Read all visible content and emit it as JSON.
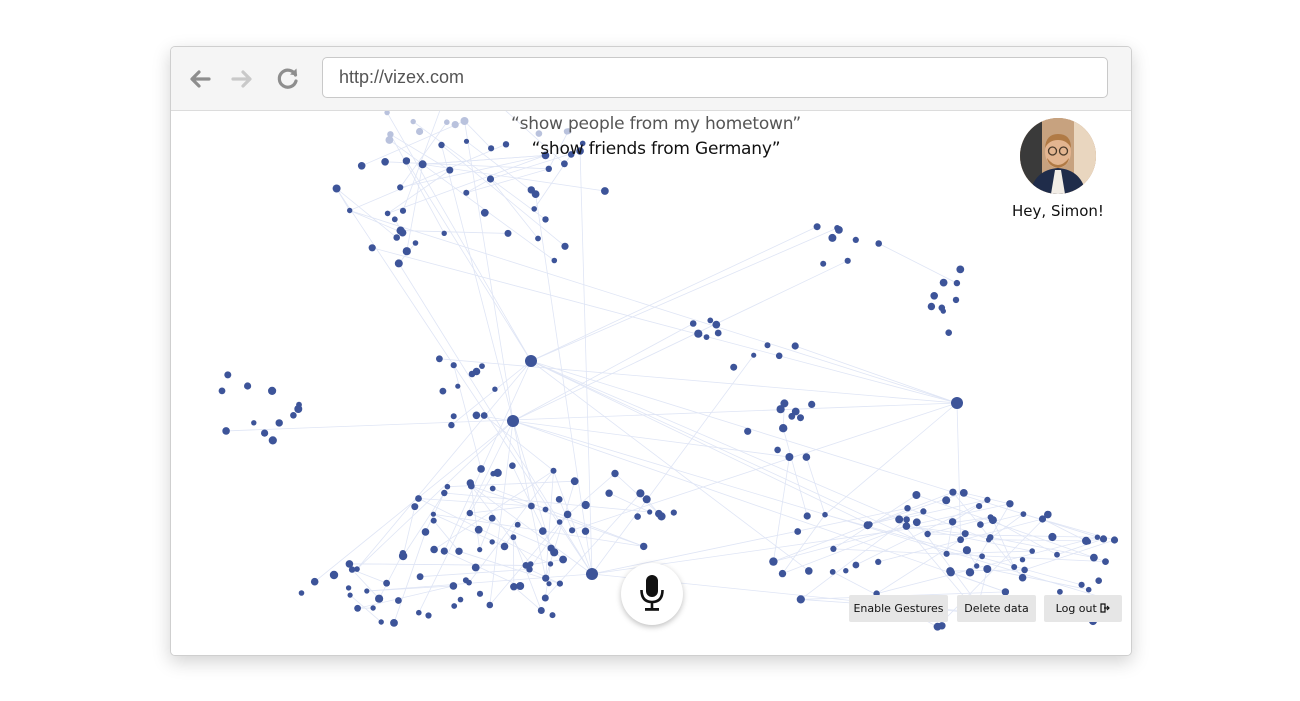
{
  "browser": {
    "url": "http://vizex.com",
    "back_icon": "arrow-left-icon",
    "forward_icon": "arrow-right-icon",
    "reload_icon": "reload-icon"
  },
  "voice_queries": [
    "“show people from my hometown”",
    "“show friends from Germany”"
  ],
  "user": {
    "greeting": "Hey, Simon!"
  },
  "mic": {
    "icon": "microphone-icon"
  },
  "actions": {
    "enable_gestures": "Enable Gestures",
    "delete_data": "Delete data",
    "log_out": "Log out",
    "log_out_icon": "logout-icon"
  },
  "colors": {
    "node": "#3d5499",
    "edge": "#dfe5f5",
    "button_bg": "#e6e6e6"
  }
}
